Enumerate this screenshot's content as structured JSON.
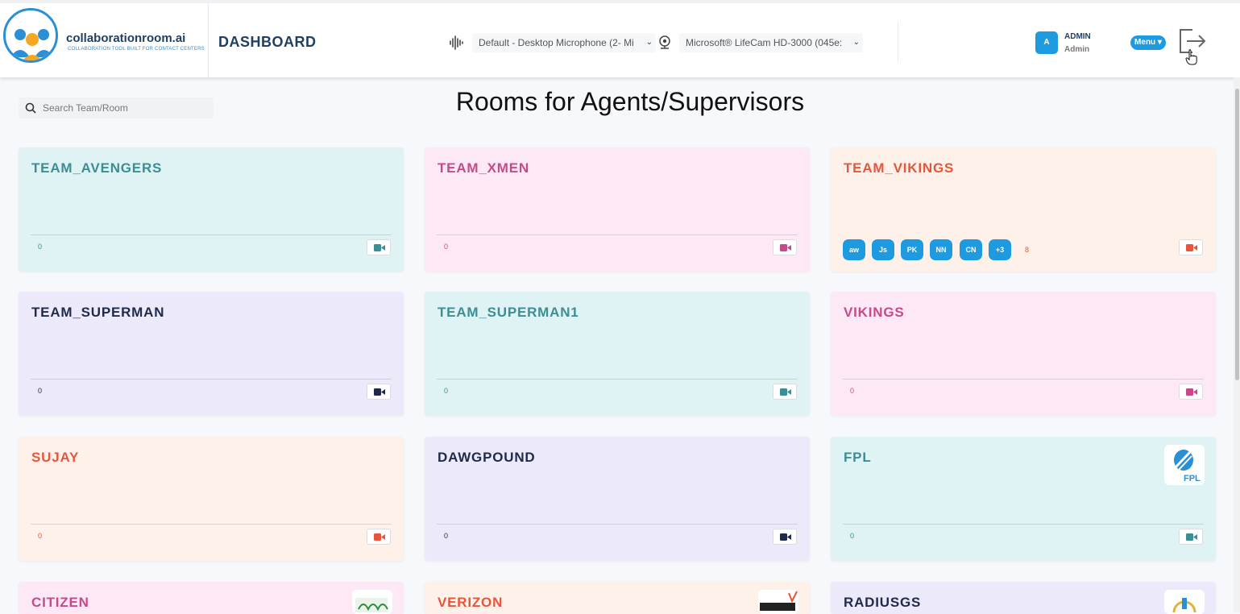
{
  "header": {
    "brand": "collaborationroom.ai",
    "tagline": "COLLABORATION TOOL BUILT FOR CONTACT CENTERS",
    "title": "DASHBOARD",
    "microphone_select": "Default - Desktop Microphone (2- Mi",
    "camera_select": "Microsoft® LifeCam HD-3000 (045e:",
    "user_initial": "A",
    "user_name": "ADMIN",
    "user_role": "Admin",
    "menu_label": "Menu ▾"
  },
  "search": {
    "placeholder": "Search Team/Room"
  },
  "page_title": "Rooms for Agents/Supervisors",
  "rooms": [
    {
      "name": "TEAM_AVENGERS",
      "count": "0"
    },
    {
      "name": "TEAM_XMEN",
      "count": "0"
    },
    {
      "name": "TEAM_VIKINGS",
      "members": [
        "aw",
        "Js",
        "PK",
        "NN",
        "CN",
        "+3"
      ],
      "count": "8"
    },
    {
      "name": "TEAM_SUPERMAN",
      "count": "0"
    },
    {
      "name": "TEAM_SUPERMAN1",
      "count": "0"
    },
    {
      "name": "VIKINGS",
      "count": "0"
    },
    {
      "name": "SUJAY",
      "count": "0"
    },
    {
      "name": "DAWGPOUND",
      "count": "0"
    },
    {
      "name": "FPL",
      "count": "0",
      "logo_text": "FPL"
    },
    {
      "name": "CITIZEN"
    },
    {
      "name": "VERIZON"
    },
    {
      "name": "RADIUSGS"
    }
  ],
  "colors": {
    "teal_bg": "#dff2f4",
    "teal_fg": "#3b8e93",
    "pink_bg": "#fde8f6",
    "pink_fg": "#c64a8a",
    "peach_bg": "#fef1ea",
    "peach_fg": "#e8553b",
    "lav_bg": "#ece9fb",
    "lav_fg": "#1f2a4a",
    "accent": "#1e9be0"
  }
}
